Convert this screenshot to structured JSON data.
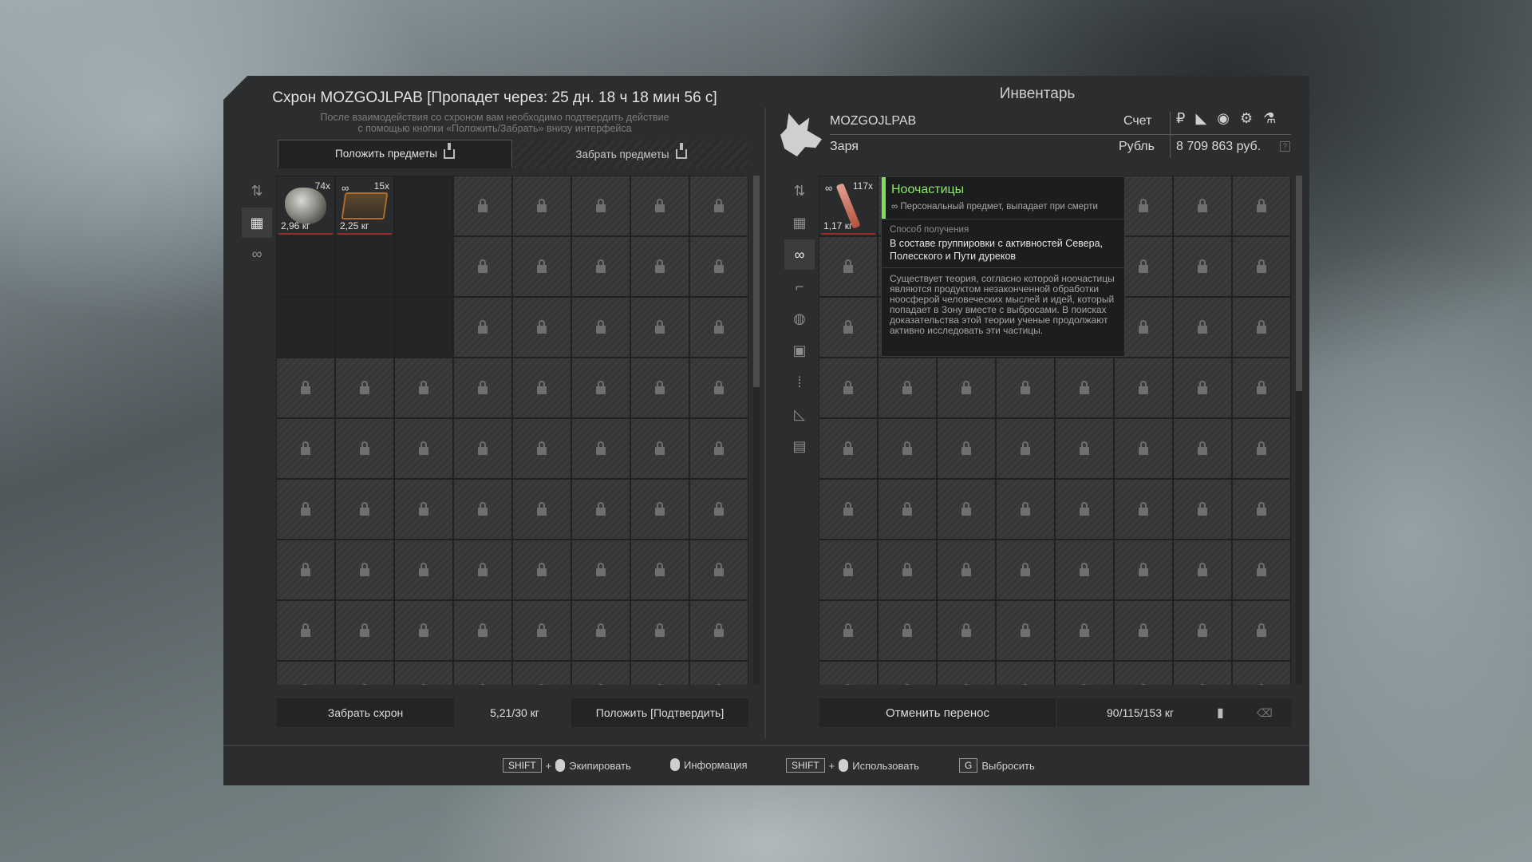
{
  "stash": {
    "title": "Схрон MOZGOJLPAB [Пропадет через: 25 дн. 18 ч 18 мин 56 с]",
    "subtitle_line1": "После взаимодействия со схроном вам необходимо подтвердить действие",
    "subtitle_line2": "с помощью кнопки «Положить/Забрать» внизу интерфейса",
    "tab_put": "Положить предметы",
    "tab_take": "Забрать предметы",
    "items": [
      {
        "qty": "74x",
        "weight": "2,96 кг",
        "icon": "artifact-rock-icon"
      },
      {
        "qty": "15x",
        "weight": "2,25 кг",
        "icon": "ammo-box-icon"
      }
    ],
    "take_stash_label": "Забрать схрон",
    "weight": "5,21/30 кг",
    "confirm_label": "Положить [Подтвердить]"
  },
  "inventory": {
    "title": "Инвентарь",
    "player_name": "MOZGOJLPAB",
    "faction": "Заря",
    "account_label": "Счет",
    "currency_label": "Рубль",
    "money": "8 709 863 руб.",
    "currency_icons": "₽ ◣ ◉ ⚙ ⚗",
    "item": {
      "qty": "117x",
      "weight": "1,17 кг",
      "icon": "noo-particles-icon"
    },
    "cancel_label": "Отменить перенос",
    "weight": "90/115/153 кг"
  },
  "tooltip": {
    "title": "Ноочастицы",
    "note": "Персональный предмет, выпадает при смерти",
    "source_header": "Способ получения",
    "source": "В составе группировки с активностей Севера, Полесского и Пути дуреков",
    "description": "Существует теория, согласно которой ноочастицы являются продуктом незаконченной обработки ноосферой человеческих мыслей и идей, который попадает в Зону вместе с выбросами. В поисках доказательства этой теории ученые продолжают активно исследовать эти частицы.",
    "accent": "#7ee05a"
  },
  "hints": {
    "shift": "SHIFT",
    "plus": "+",
    "equip": "Экипировать",
    "info": "Информация",
    "use": "Использовать",
    "g": "G",
    "drop": "Выбросить"
  }
}
